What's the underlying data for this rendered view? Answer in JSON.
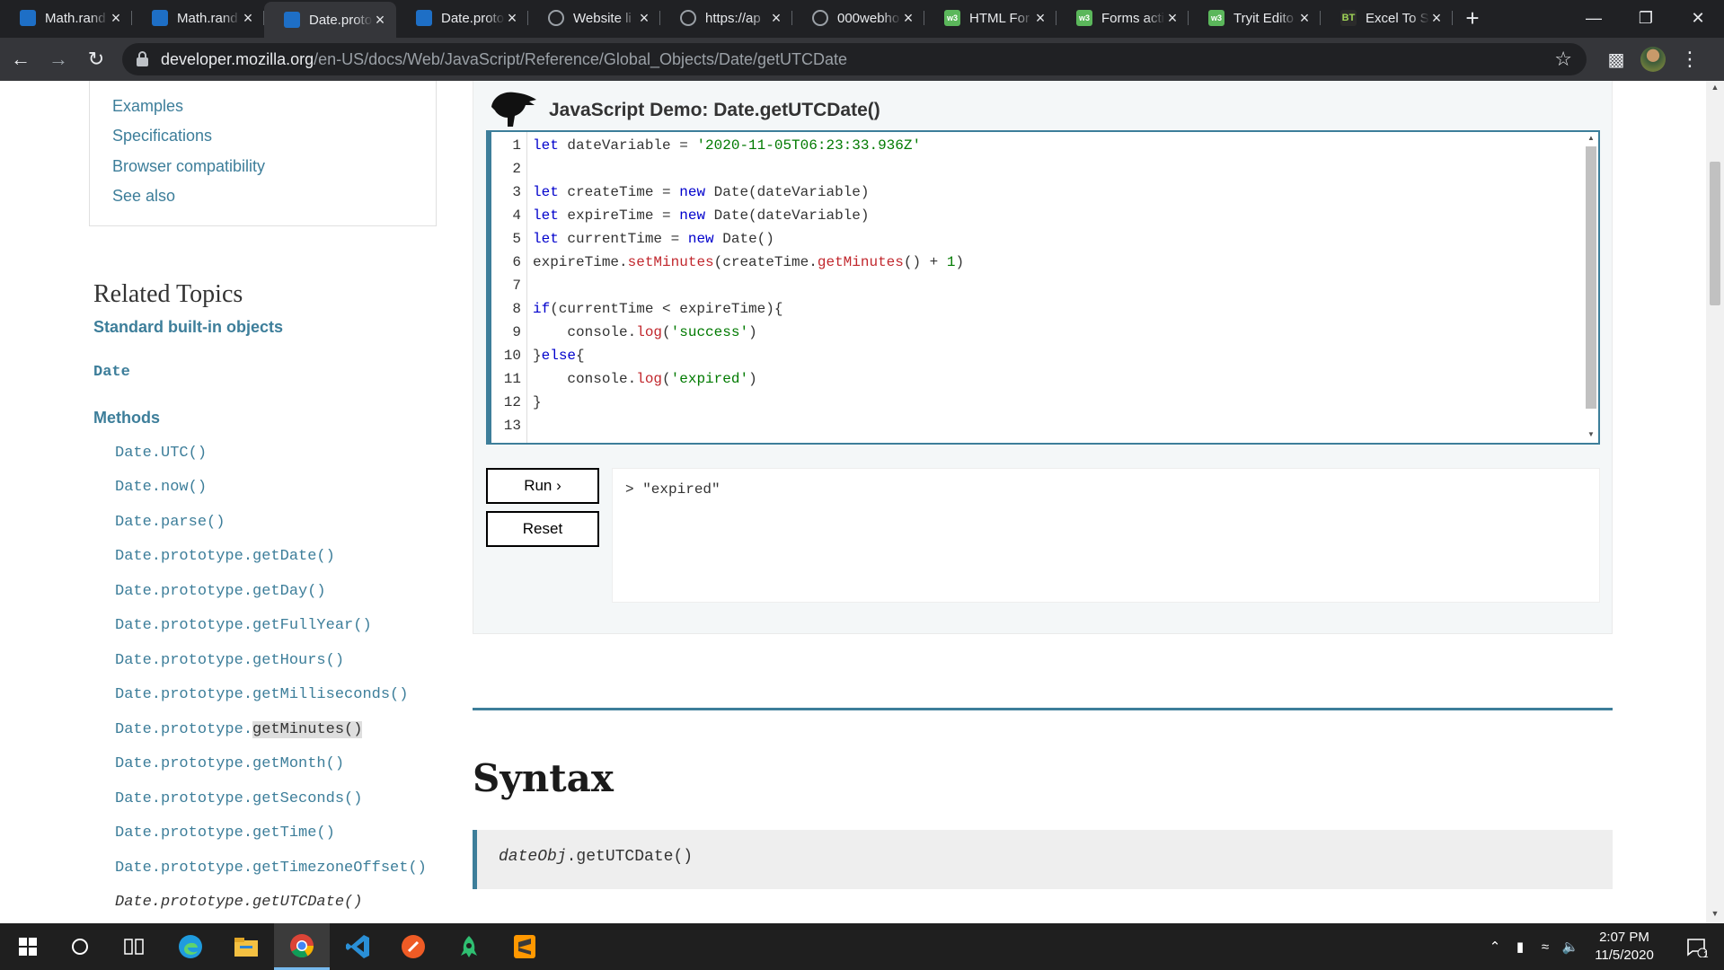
{
  "browser": {
    "tabs": [
      {
        "title": "Math.rand",
        "favicon": "mdn",
        "active": false
      },
      {
        "title": "Math.rand",
        "favicon": "mdn",
        "active": false
      },
      {
        "title": "Date.proto",
        "favicon": "mdn",
        "active": true
      },
      {
        "title": "Date.proto",
        "favicon": "mdn",
        "active": false
      },
      {
        "title": "Website li",
        "favicon": "globe",
        "active": false
      },
      {
        "title": "https://ap",
        "favicon": "globe",
        "active": false
      },
      {
        "title": "000webho",
        "favicon": "globe",
        "active": false
      },
      {
        "title": "HTML For",
        "favicon": "w3",
        "active": false
      },
      {
        "title": "Forms acti",
        "favicon": "w3",
        "active": false
      },
      {
        "title": "Tryit Edito",
        "favicon": "w3",
        "active": false
      },
      {
        "title": "Excel To S",
        "favicon": "bt",
        "active": false
      }
    ],
    "favicon_text": {
      "w3": "w3",
      "bt": "BT"
    },
    "url_host": "developer.mozilla.org",
    "url_path": "/en-US/docs/Web/JavaScript/Reference/Global_Objects/Date/getUTCDate"
  },
  "sidebar": {
    "toc": [
      "Examples",
      "Specifications",
      "Browser compatibility",
      "See also"
    ],
    "related_title": "Related Topics",
    "related_subtitle": "Standard built-in objects",
    "date_link": "Date",
    "methods_title": "Methods",
    "methods": [
      "Date.UTC()",
      "Date.now()",
      "Date.parse()",
      "Date.prototype.getDate()",
      "Date.prototype.getDay()",
      "Date.prototype.getFullYear()",
      "Date.prototype.getHours()",
      "Date.prototype.getMilliseconds()",
      "Date.prototype.getMinutes()",
      "Date.prototype.getMonth()",
      "Date.prototype.getSeconds()",
      "Date.prototype.getTime()",
      "Date.prototype.getTimezoneOffset()",
      "Date.prototype.getUTCDate()"
    ],
    "highlight_prefix": "Date.prototype.",
    "highlight_text": "getMinutes()"
  },
  "demo": {
    "title": "JavaScript Demo: Date.getUTCDate()",
    "code_lines": [
      "let dateVariable = '2020-11-05T06:23:33.936Z'",
      "",
      "let createTime = new Date(dateVariable)",
      "let expireTime = new Date(dateVariable)",
      "let currentTime = new Date()",
      "expireTime.setMinutes(createTime.getMinutes() + 1)",
      "",
      "if(currentTime < expireTime){",
      "    console.log('success')",
      "}else{",
      "    console.log('expired')",
      "}",
      ""
    ],
    "run_label": "Run ›",
    "reset_label": "Reset",
    "output": "> \"expired\""
  },
  "content": {
    "syntax_heading": "Syntax",
    "syntax_obj": "dateObj",
    "syntax_method": ".getUTCDate()"
  },
  "taskbar": {
    "time": "2:07 PM",
    "date": "11/5/2020",
    "notification_count": "1"
  }
}
